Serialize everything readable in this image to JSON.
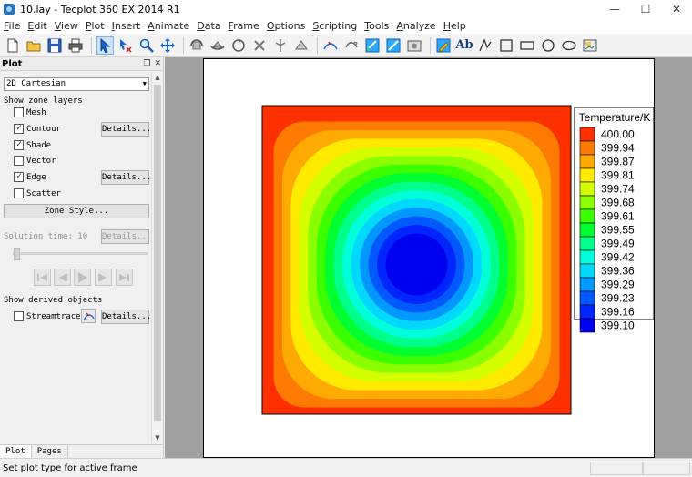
{
  "window": {
    "title": "10.lay - Tecplot 360 EX 2014 R1",
    "minimize": "—",
    "maximize": "☐",
    "close": "✕"
  },
  "menu": [
    {
      "label": "File",
      "acc": "F",
      "rest": "ile",
      "enabled": true
    },
    {
      "label": "Edit",
      "acc": "E",
      "rest": "dit",
      "enabled": true
    },
    {
      "label": "View",
      "acc": "V",
      "rest": "iew",
      "enabled": true
    },
    {
      "label": "Plot",
      "acc": "P",
      "rest": "lot",
      "enabled": true
    },
    {
      "label": "Insert",
      "acc": "I",
      "rest": "nsert",
      "enabled": true
    },
    {
      "label": "Animate",
      "acc": "A",
      "rest": "nimate",
      "enabled": true
    },
    {
      "label": "Data",
      "acc": "D",
      "rest": "ata",
      "enabled": true
    },
    {
      "label": "Frame",
      "acc": "F",
      "rest": "rame",
      "enabled": true
    },
    {
      "label": "Options",
      "acc": "O",
      "rest": "ptions",
      "enabled": true
    },
    {
      "label": "Scripting",
      "acc": "S",
      "rest": "cripting",
      "enabled": true
    },
    {
      "label": "Tools",
      "acc": "T",
      "rest": "ools",
      "enabled": true
    },
    {
      "label": "Analyze",
      "acc": "A",
      "rest": "nalyze",
      "enabled": true
    },
    {
      "label": "Help",
      "acc": "H",
      "rest": "elp",
      "enabled": true
    }
  ],
  "toolbar": {
    "text_tool_label": "Ab",
    "icons": [
      "new-layout-icon",
      "open-layout-icon",
      "save-layout-icon",
      "print-icon",
      "select-icon",
      "adjust-icon",
      "zoom-icon",
      "translate-icon",
      "rotate-3d-icon",
      "spherical-rotate-icon",
      "rollerball-icon",
      "twist-icon",
      "probe-icon",
      "slice-icon",
      "streamtrace-icon",
      "isosurface-icon",
      "contour-icon",
      "export-icon",
      "snapshot-icon",
      "quick-edit-icon",
      "text-icon",
      "polyline-icon",
      "square-icon",
      "rectangle-icon",
      "circle-icon",
      "ellipse-icon",
      "image-icon"
    ]
  },
  "panel": {
    "title": "Plot",
    "plot_type": "2D Cartesian",
    "show_zone_layers": "Show zone layers",
    "layers": [
      {
        "label": "Mesh",
        "checked": false,
        "details": false
      },
      {
        "label": "Contour",
        "checked": true,
        "details": true
      },
      {
        "label": "Shade",
        "checked": true,
        "details": false
      },
      {
        "label": "Vector",
        "checked": false,
        "details": false
      },
      {
        "label": "Edge",
        "checked": true,
        "details": true
      },
      {
        "label": "Scatter",
        "checked": false,
        "details": false
      }
    ],
    "details_label": "Details...",
    "zone_style_label": "Zone Style...",
    "solution_time": "Solution time: 10",
    "show_derived": "Show derived objects",
    "streamtraces_label": "Streamtraces",
    "streamtraces_checked": false,
    "tabs": [
      "Plot",
      "Pages"
    ]
  },
  "plot": {
    "legend_title": "Temperature/K",
    "contour_levels": [
      {
        "value": "400.00",
        "color": "#ff3000"
      },
      {
        "value": "399.94",
        "color": "#ff7a00"
      },
      {
        "value": "399.87",
        "color": "#ffaa00"
      },
      {
        "value": "399.81",
        "color": "#ffea00"
      },
      {
        "value": "399.74",
        "color": "#d4ff00"
      },
      {
        "value": "399.68",
        "color": "#8bff00"
      },
      {
        "value": "399.61",
        "color": "#3cff00"
      },
      {
        "value": "399.55",
        "color": "#00ff30"
      },
      {
        "value": "399.49",
        "color": "#00ff8a"
      },
      {
        "value": "399.42",
        "color": "#00ffd8"
      },
      {
        "value": "399.36",
        "color": "#00d8ff"
      },
      {
        "value": "399.29",
        "color": "#0098ff"
      },
      {
        "value": "399.23",
        "color": "#0058ff"
      },
      {
        "value": "399.16",
        "color": "#0025ff"
      },
      {
        "value": "399.10",
        "color": "#0000f0"
      }
    ]
  },
  "status": {
    "text": "Set plot type for active frame"
  }
}
